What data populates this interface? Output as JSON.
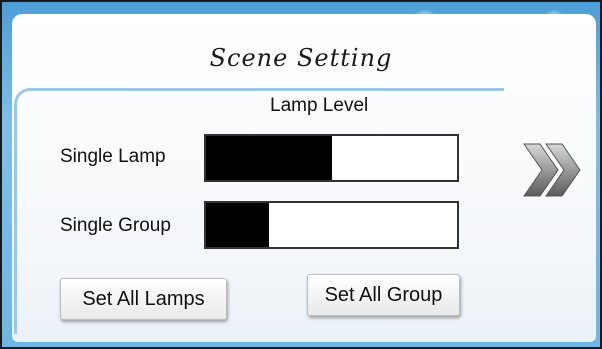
{
  "screen": {
    "title": "Scene  Setting",
    "section_label": "Lamp Level"
  },
  "levels": [
    {
      "label": "Single Lamp",
      "value": 0.5
    },
    {
      "label": "Single Group",
      "value": 0.25
    }
  ],
  "buttons": {
    "set_all_lamps": "Set All Lamps",
    "set_all_group": "Set All Group"
  },
  "icons": {
    "next": "double-chevron-right-icon"
  },
  "colors": {
    "frame_blue": "#6fb6e4",
    "bar_fill": "#000000"
  }
}
